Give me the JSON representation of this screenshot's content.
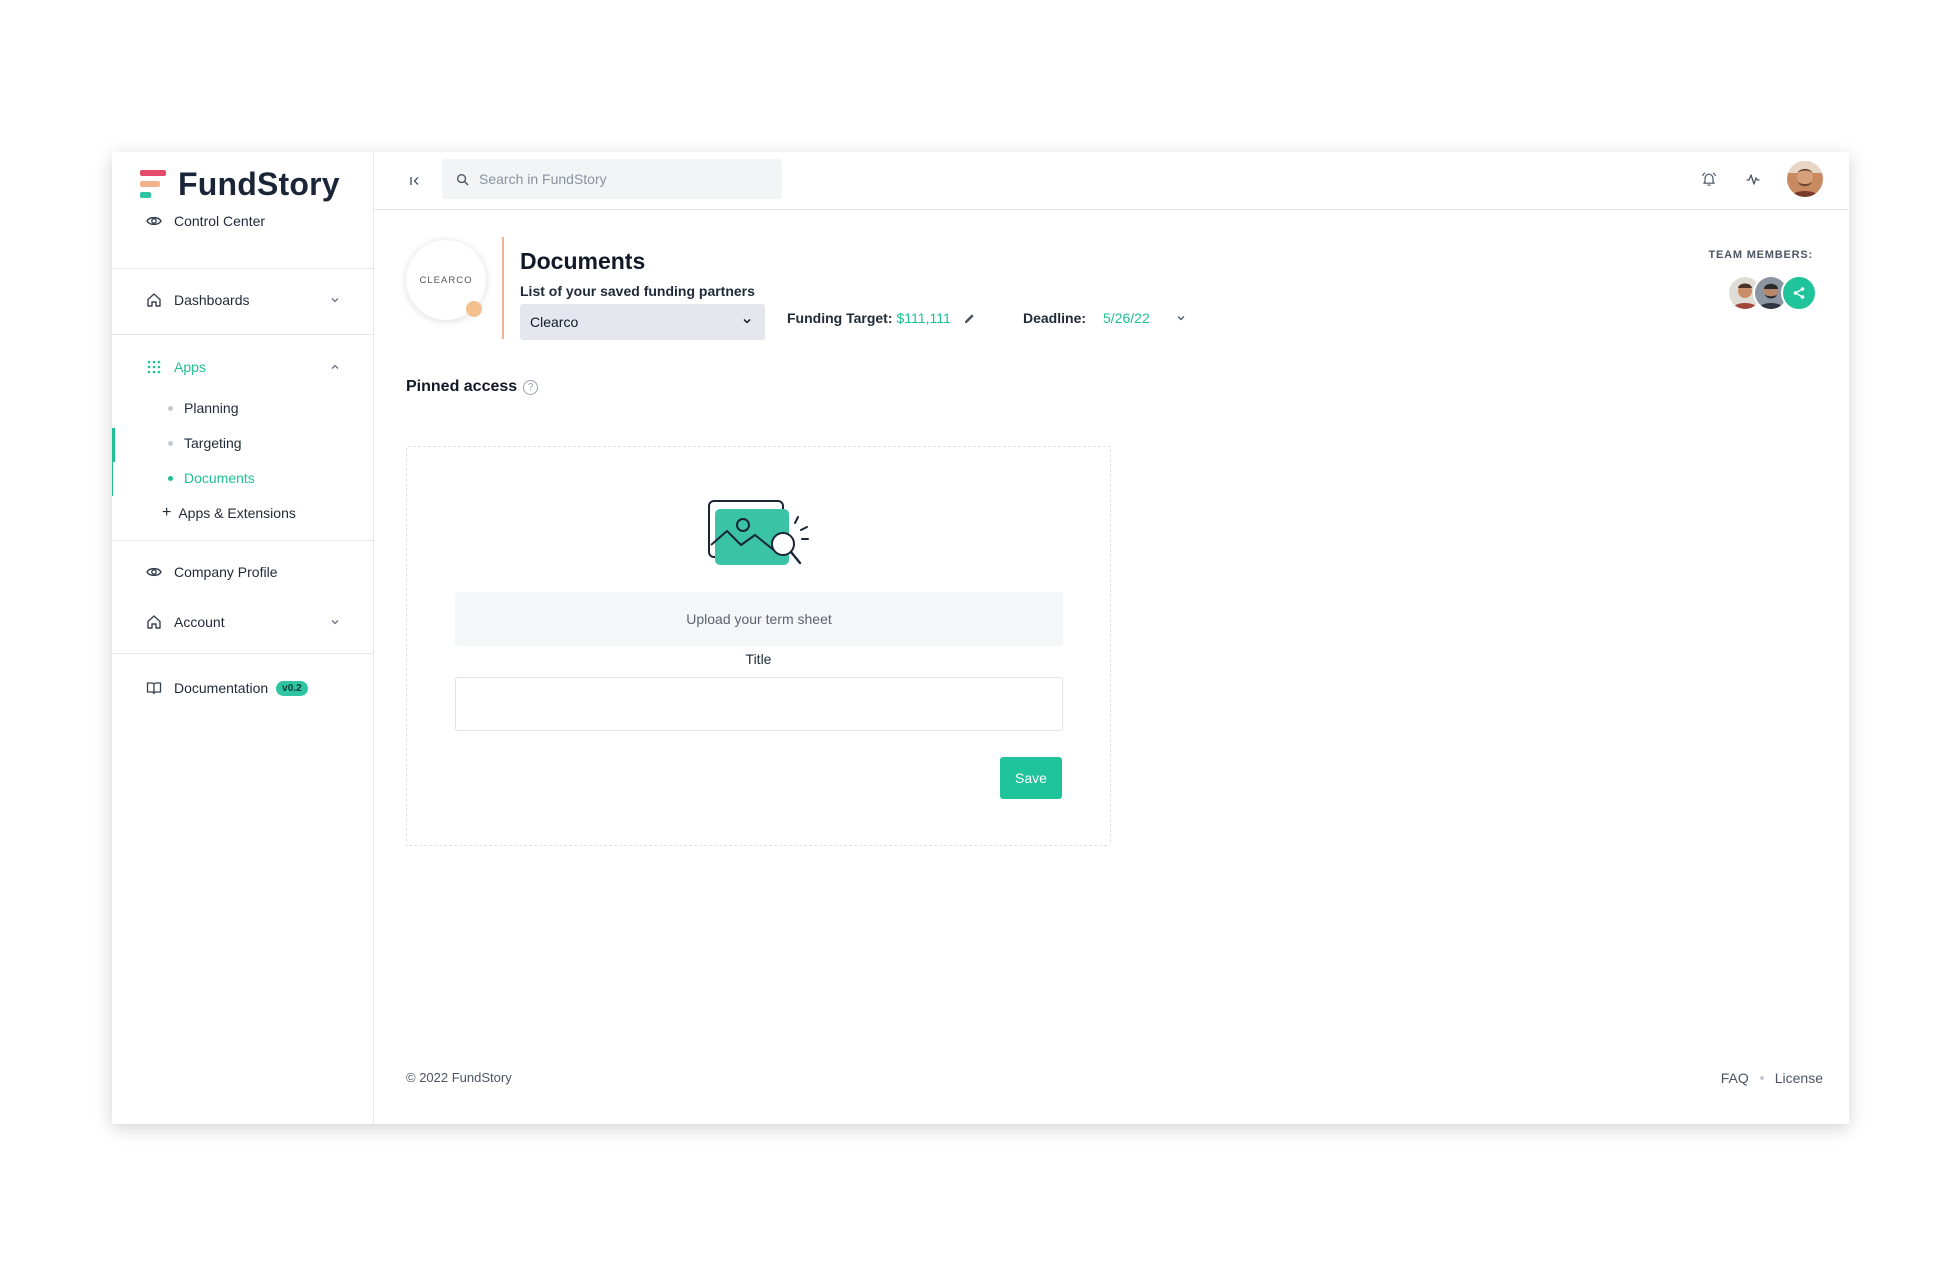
{
  "brand": {
    "name": "FundStory"
  },
  "sidebar": {
    "control_center": "Control Center",
    "dashboards": "Dashboards",
    "apps": "Apps",
    "apps_items": [
      "Planning",
      "Targeting",
      "Documents"
    ],
    "apps_extensions": "Apps & Extensions",
    "company_profile": "Company Profile",
    "account": "Account",
    "documentation": "Documentation",
    "documentation_badge": "v0.2"
  },
  "topbar": {
    "search_placeholder": "Search in FundStory",
    "icons": [
      "collapse-icon",
      "search-icon",
      "bell-icon",
      "activity-icon"
    ]
  },
  "page": {
    "partner_logo_text": "CLEARCO",
    "title": "Documents",
    "subtitle": "List of your saved funding partners",
    "selected_partner": "Clearco",
    "funding_target_label": "Funding Target:",
    "funding_target_value": "$111,111",
    "deadline_label": "Deadline:",
    "deadline_value": "5/26/22",
    "team_members_label": "TEAM MEMBERS:",
    "pinned_access": "Pinned access",
    "help_glyph": "?"
  },
  "upload_card": {
    "upload_label": "Upload your term sheet",
    "title_label": "Title",
    "title_value": "",
    "save_label": "Save"
  },
  "footer": {
    "copyright": "© 2022 FundStory",
    "faq": "FAQ",
    "license": "License"
  },
  "colors": {
    "accent": "#1fc49a",
    "logo_pink": "#e54b6a",
    "logo_peach": "#f2b38c",
    "logo_green": "#2fc5a2"
  }
}
